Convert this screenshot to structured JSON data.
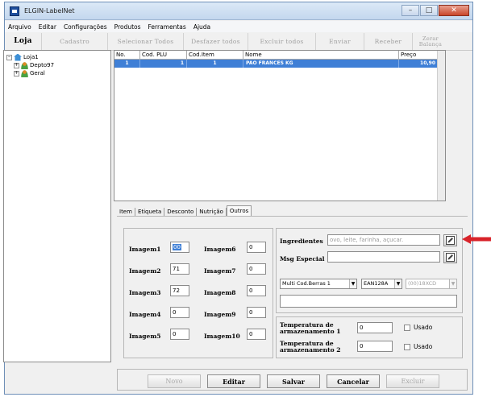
{
  "window": {
    "title": "ELGIN-LabelNet"
  },
  "menu": [
    "Arquivo",
    "Editar",
    "Configurações",
    "Produtos",
    "Ferramentas",
    "Ajuda"
  ],
  "toolbar": {
    "loja": "Loja",
    "cadastro": "Cadastro",
    "selecionar_todos": "Selecionar Todos",
    "desfazer_todos": "Desfazer todos",
    "excluir_todos": "Excluir todos",
    "enviar": "Enviar",
    "receber": "Receber",
    "zerar_line1": "Zerar",
    "zerar_line2": "Balança"
  },
  "tree": {
    "root": "Loja1",
    "children": [
      "Depto97",
      "Geral"
    ]
  },
  "grid": {
    "columns": [
      "No.",
      "Cod. PLU",
      "Cod.Item",
      "Nome",
      "Preço"
    ],
    "rows": [
      {
        "no": "1",
        "plu": "1",
        "item": "1",
        "nome": "PAO FRANCES KG",
        "preco": "10,90"
      }
    ]
  },
  "tabs": [
    "Item",
    "Etiqueta",
    "Desconto",
    "Nutrição",
    "Outros"
  ],
  "active_tab": "Outros",
  "imagens": [
    {
      "label": "Imagem1",
      "value": "00"
    },
    {
      "label": "Imagem2",
      "value": "71"
    },
    {
      "label": "Imagem3",
      "value": "72"
    },
    {
      "label": "Imagem4",
      "value": "0"
    },
    {
      "label": "Imagem5",
      "value": "0"
    },
    {
      "label": "Imagem6",
      "value": "0"
    },
    {
      "label": "Imagem7",
      "value": "0"
    },
    {
      "label": "Imagem8",
      "value": "0"
    },
    {
      "label": "Imagem9",
      "value": "0"
    },
    {
      "label": "Imagem10",
      "value": "0"
    }
  ],
  "ingredientes": {
    "label": "Ingredientes",
    "placeholder": "ovo, leite, farinha, açucar."
  },
  "msg_especial": {
    "label": "Msg Especial",
    "value": ""
  },
  "barcode": {
    "type": "Multi Cod.Berras 1",
    "standard": "EAN128A",
    "format": "(00)18XCD"
  },
  "temperatura1": {
    "label_line1": "Temperatura de",
    "label_line2": "armazenamento 1",
    "value": "0",
    "usado": "Usado"
  },
  "temperatura2": {
    "label_line1": "Temperatura de",
    "label_line2": "armazenamento 2",
    "value": "0",
    "usado": "Usado"
  },
  "buttons": {
    "novo": "Novo",
    "editar": "Editar",
    "salvar": "Salvar",
    "cancelar": "Cancelar",
    "excluir": "Excluir"
  },
  "colors": {
    "selection": "#3f7fd6",
    "annotation_arrow": "#d8232a"
  }
}
